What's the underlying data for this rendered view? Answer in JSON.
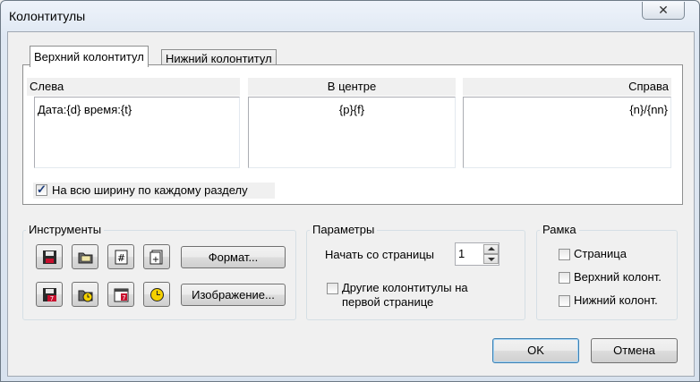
{
  "window": {
    "title": "Колонтитулы",
    "close_glyph": "✕"
  },
  "tabs": [
    {
      "label": "Верхний колонтитул",
      "active": true
    },
    {
      "label": "Нижний колонтитул",
      "active": false
    }
  ],
  "columns": [
    {
      "header": "Слева",
      "value": "Дата:{d}  время:{t}",
      "align": "left"
    },
    {
      "header": "В центре",
      "value": "{p}{f}",
      "align": "center"
    },
    {
      "header": "Справа",
      "value": "{n}/{nn}",
      "align": "right"
    }
  ],
  "full_width_checkbox": {
    "label": "На всю ширину по каждому разделу",
    "checked": true
  },
  "tools": {
    "title": "Инструменты",
    "icons": [
      "save-icon",
      "open-folder-icon",
      "page-number-icon",
      "page-count-icon",
      "date-icon",
      "time-icon",
      "calendar-icon",
      "clock-icon"
    ],
    "format_label": "Формат...",
    "image_label": "Изображение..."
  },
  "params": {
    "title": "Параметры",
    "start_page_label": "Начать со страницы",
    "start_page_value": "1",
    "first_page_label_line1": "Другие колонтитулы на",
    "first_page_label_line2": "первой странице",
    "first_page_checked": false
  },
  "frame": {
    "title": "Рамка",
    "options": [
      {
        "label": "Страница",
        "checked": false
      },
      {
        "label": "Верхний колонт.",
        "checked": false
      },
      {
        "label": "Нижний колонт.",
        "checked": false
      }
    ]
  },
  "buttons": {
    "ok": "OK",
    "cancel": "Отмена"
  }
}
